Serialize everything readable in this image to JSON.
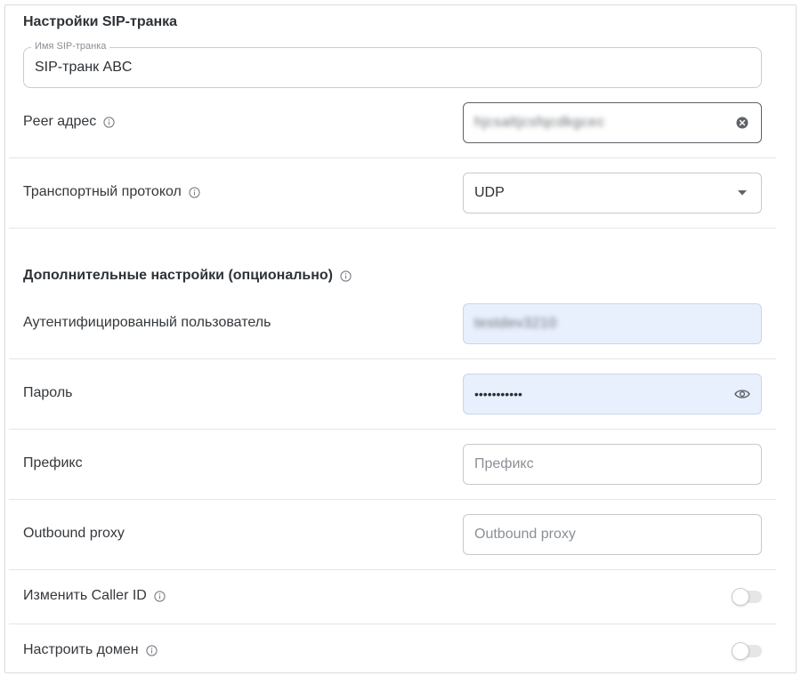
{
  "section_title": "Настройки SIP-транка",
  "trunk_name": {
    "legend": "Имя SIP-транка",
    "value": "SIP-транк ABC"
  },
  "peer_address": {
    "label": "Peer адрес",
    "value": "hjcsaltjcsfqcdkgcec",
    "clear_icon": "close-circle-icon",
    "info_icon": "info-icon"
  },
  "transport": {
    "label": "Транспортный протокол",
    "value": "UDP",
    "dropdown_icon": "caret-down-icon"
  },
  "advanced": {
    "title": "Дополнительные настройки (опционально)",
    "auth_user": {
      "label": "Аутентифицированный пользователь",
      "value": "testdev3210"
    },
    "password": {
      "label": "Пароль",
      "value": "•••••••••••",
      "visibility_icon": "eye-icon"
    },
    "prefix": {
      "label": "Префикс",
      "placeholder": "Префикс"
    },
    "outbound_proxy": {
      "label": "Outbound proxy",
      "placeholder": "Outbound proxy"
    },
    "change_caller_id": {
      "label": "Изменить Caller ID",
      "enabled": false
    },
    "setup_domain": {
      "label": "Настроить домен",
      "enabled": false
    }
  },
  "colors": {
    "accent_fill": "#e8effd",
    "text": "#2b2f33",
    "muted": "#8b9096"
  }
}
